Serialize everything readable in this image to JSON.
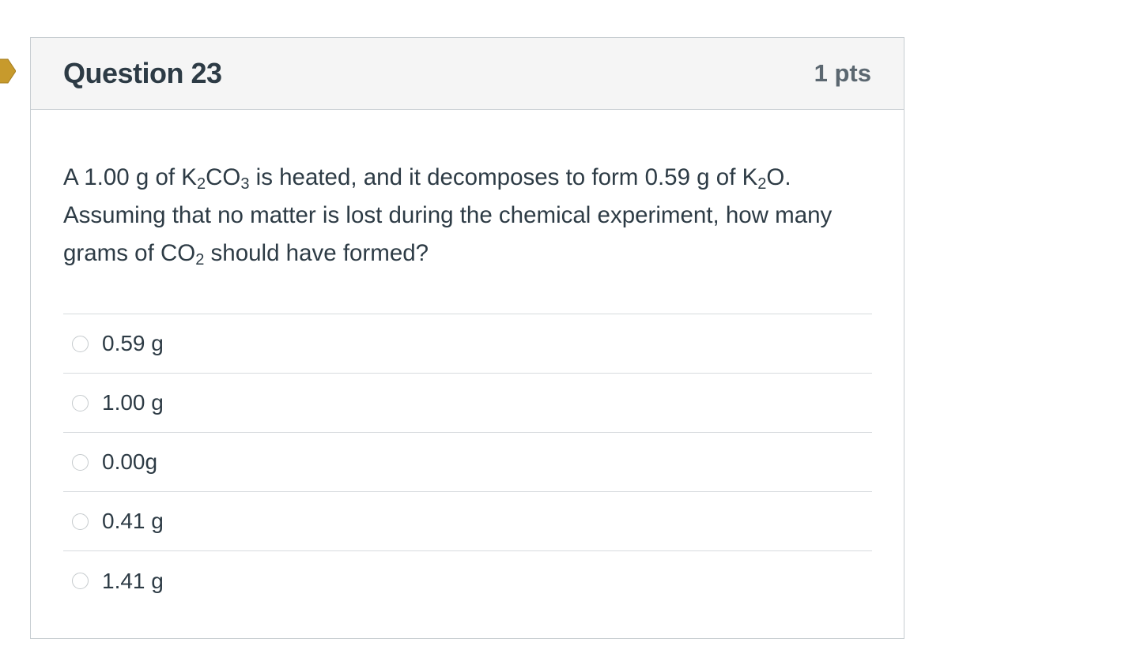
{
  "question": {
    "title": "Question 23",
    "points": "1 pts",
    "text_parts": {
      "p1": "A 1.00 g of K",
      "s1": "2",
      "p2": "CO",
      "s2": "3",
      "p3": " is heated, and it decomposes to form 0.59 g of K",
      "s3": "2",
      "p4": "O. Assuming that no matter is lost during the chemical experiment, how many grams of CO",
      "s4": "2",
      "p5": " should have formed?"
    },
    "answers": [
      {
        "label": "0.59 g",
        "selected": false
      },
      {
        "label": "1.00 g",
        "selected": false
      },
      {
        "label": "0.00g",
        "selected": false
      },
      {
        "label": "0.41 g",
        "selected": false
      },
      {
        "label": "1.41 g",
        "selected": false
      }
    ]
  },
  "colors": {
    "flag": "#c79a2c",
    "header_bg": "#f5f5f5",
    "border": "#c7cdd1",
    "text": "#2d3b45"
  },
  "icons": {
    "flag": "flag-question-icon",
    "radio": "radio-button-icon"
  }
}
